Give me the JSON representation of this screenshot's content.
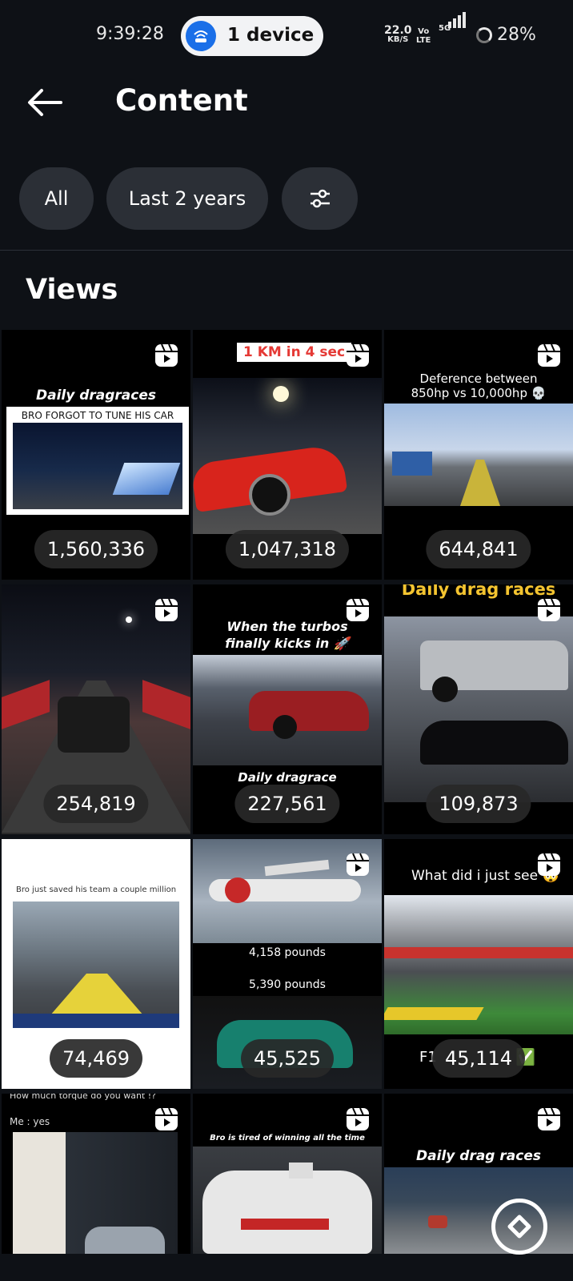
{
  "status_bar": {
    "time": "9:39:28",
    "device_pill": "1 device",
    "net_speed_value": "22.0",
    "net_speed_unit": "KB/S",
    "volte_top": "Vo",
    "volte_bottom": "LTE",
    "network": "5G",
    "battery": "28%"
  },
  "header": {
    "title": "Content"
  },
  "filters": {
    "all": "All",
    "period": "Last 2 years"
  },
  "section": {
    "title": "Views"
  },
  "tiles": [
    {
      "views": "1,560,336",
      "caption": "Daily dragraces",
      "subcaption": "BRO FORGOT TO TUNE HIS CAR"
    },
    {
      "views": "1,047,318",
      "caption": "1 KM in 4 sec"
    },
    {
      "views": "644,841",
      "caption": "Deference between 850hp vs 10,000hp 💀"
    },
    {
      "views": "254,819"
    },
    {
      "views": "227,561",
      "caption": "When the turbos finally kicks in 🚀",
      "subcaption": "Daily dragrace"
    },
    {
      "views": "109,873",
      "caption": "Daily drag races"
    },
    {
      "views": "74,469",
      "caption": "Bro just saved his team a couple million"
    },
    {
      "views": "45,525",
      "caption": "4,158 pounds",
      "subcaption": "5,390 pounds"
    },
    {
      "views": "45,114",
      "caption": "What did i just see 🤯",
      "subcaption": "F1",
      "emoji": "✅"
    },
    {
      "caption": "How much torque do you want !?",
      "subcaption": "Me : yes"
    },
    {
      "caption": "Bro is tired of winning all the time"
    },
    {
      "caption": "Daily drag races"
    }
  ],
  "colors": {
    "background": "#0e1116",
    "chip": "#2b2f36",
    "accent": "#1a6fe8"
  }
}
